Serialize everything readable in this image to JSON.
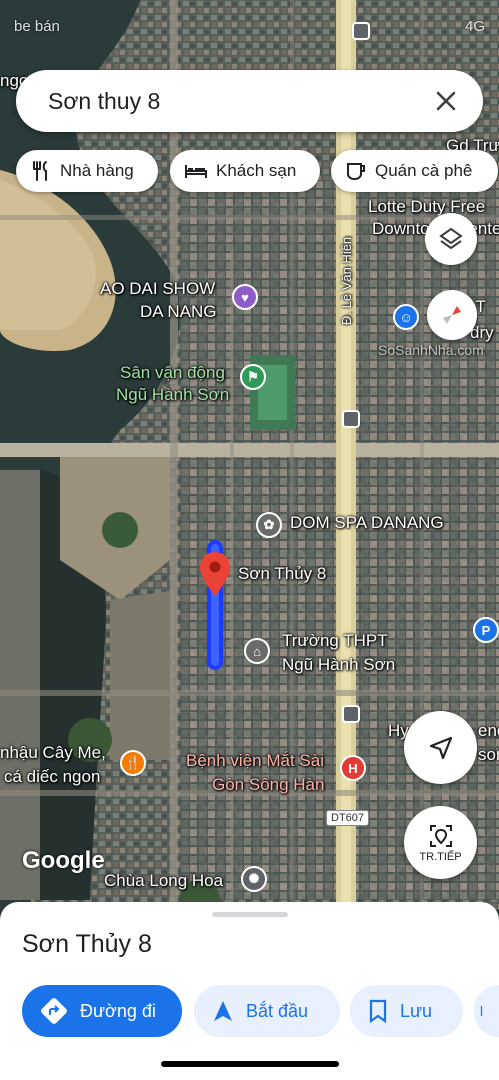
{
  "search": {
    "query": "Sơn thuy 8"
  },
  "status_bar": {
    "left": "be bán",
    "right": "4G"
  },
  "chips": [
    {
      "label": "Nhà hàng",
      "icon": "restaurant-icon"
    },
    {
      "label": "Khách sạn",
      "icon": "hotel-icon"
    },
    {
      "label": "Quán cà phê",
      "icon": "coffee-icon"
    }
  ],
  "map": {
    "street_labels": {
      "le_van_hien": "Đ. Lê Văn Hiến",
      "dt607": "DT607"
    },
    "places": {
      "top_left_partial": "ngo",
      "gd_truong": "Gd Trư",
      "lotte_1": "Lotte Duty Free",
      "lotte_2": "Downtown Center",
      "ao_dai_1": "AO DAI SHOW",
      "ao_dai_2": "DA NANG",
      "stadium_1": "Sân vận động",
      "stadium_2": "Ngũ Hành Sơn",
      "right_partial_1": "Tí T",
      "right_partial_2": "dry",
      "watermark": "SoSanhNha.com",
      "spa": "DOM SPA DANANG",
      "pin_label": "Sơn Thủy 8",
      "school_1": "Trường THPT",
      "school_2": "Ngũ Hành Sơn",
      "hy_partial": "Hy",
      "right_partial_3": "enc",
      "right_partial_4": "son",
      "restaurant_1": "nhậu Cây Me,",
      "restaurant_2": "cá diếc ngon",
      "hospital_1": "Bệnh viện Mắt Sài",
      "hospital_2": "Gòn Sông Hàn",
      "pagoda": "Chùa Long Hoa"
    },
    "attribution": "Google"
  },
  "controls": {
    "streetview_label": "TR.TIẾP"
  },
  "sheet": {
    "place_name": "Sơn Thủy 8",
    "actions": [
      {
        "label": "Đường đi"
      },
      {
        "label": "Bắt đầu"
      },
      {
        "label": "Lưu"
      }
    ]
  },
  "colors": {
    "accent": "#1a73e8",
    "route": "#1a3cff",
    "pin": "#ea4335"
  }
}
